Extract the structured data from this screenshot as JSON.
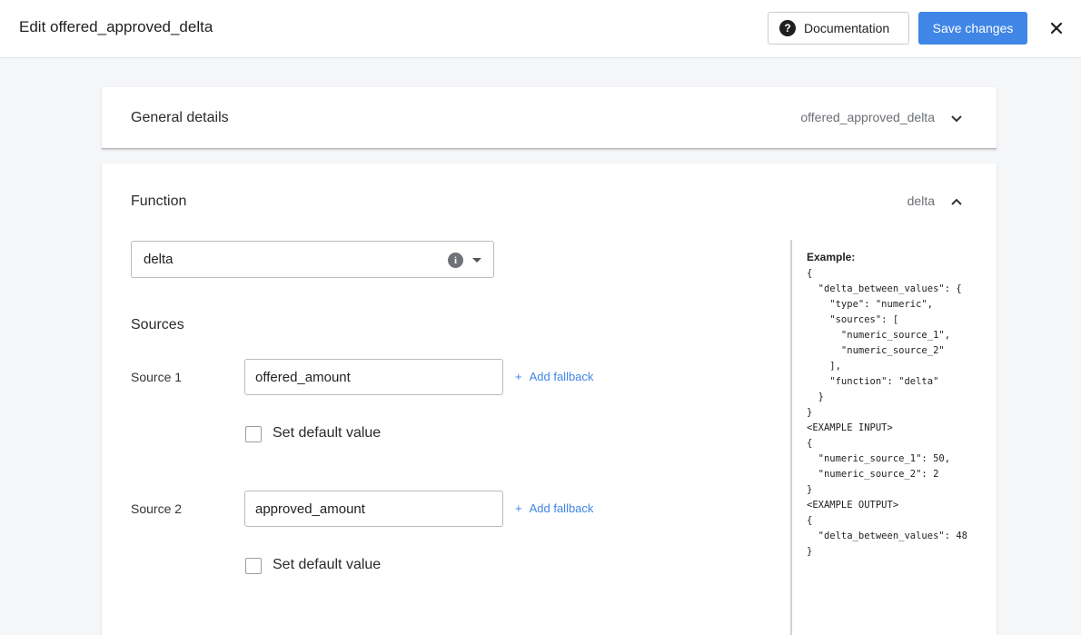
{
  "header": {
    "title": "Edit offered_approved_delta",
    "documentation_label": "Documentation",
    "save_label": "Save changes"
  },
  "general": {
    "title": "General details",
    "summary": "offered_approved_delta"
  },
  "function": {
    "title": "Function",
    "summary": "delta",
    "selected": "delta"
  },
  "sources": {
    "title": "Sources",
    "items": [
      {
        "label": "Source 1",
        "value": "offered_amount",
        "fallback_label": "Add fallback",
        "default_label": "Set default value",
        "default_checked": false
      },
      {
        "label": "Source 2",
        "value": "approved_amount",
        "fallback_label": "Add fallback",
        "default_label": "Set default value",
        "default_checked": false
      }
    ]
  },
  "example": {
    "title": "Example:",
    "code": "{\n  \"delta_between_values\": {\n    \"type\": \"numeric\",\n    \"sources\": [\n      \"numeric_source_1\",\n      \"numeric_source_2\"\n    ],\n    \"function\": \"delta\"\n  }\n}\n<EXAMPLE INPUT>\n{\n  \"numeric_source_1\": 50,\n  \"numeric_source_2\": 2\n}\n<EXAMPLE OUTPUT>\n{\n  \"delta_between_values\": 48\n}"
  },
  "icons": {
    "help": "question-circle-icon",
    "close": "close-icon",
    "expand": "chevron-down-icon",
    "collapse": "chevron-up-icon",
    "info": "info-icon",
    "dropdown": "caret-down-icon"
  },
  "colors": {
    "primary": "#3f86e6",
    "background": "#f5f6f8"
  }
}
